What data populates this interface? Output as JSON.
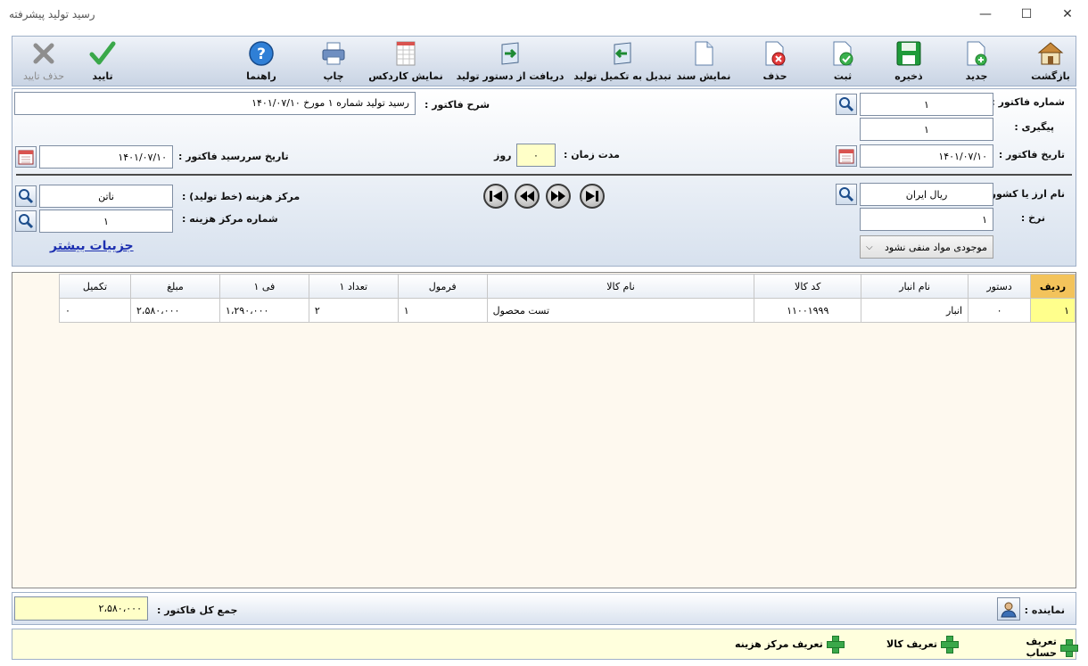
{
  "window": {
    "title": "رسید تولید  پیشرفته",
    "minimize": "—",
    "maximize": "☐",
    "close": "✕"
  },
  "toolbar": {
    "back": "بازگشت",
    "new": "جدید",
    "save": "ذخیره",
    "register": "ثبت",
    "delete": "حذف",
    "show_doc": "نمایش سند",
    "convert": "تبدیل به تکمیل تولید",
    "receive": "دریافت از دستور تولید",
    "kardex": "نمایش کاردکس",
    "print": "چاپ",
    "help": "راهنما",
    "confirm": "تایید",
    "remove_confirm": "حذف تایید"
  },
  "header": {
    "invoice_no_label": "شماره فاکتور :",
    "invoice_no": "۱",
    "followup_label": "پیگیری :",
    "followup": "۱",
    "invoice_date_label": "تاریخ فاکتور :",
    "invoice_date": "۱۴۰۱/۰۷/۱۰",
    "desc_label": "شرح فاکتور :",
    "desc": "رسید تولید شماره ۱ مورخ ۱۴۰۱/۰۷/۱۰",
    "duration_label": "مدت زمان :",
    "duration": "۰",
    "day_label": "روز",
    "due_date_label": "تاریخ سررسید فاکتور :",
    "due_date": "۱۴۰۱/۰۷/۱۰",
    "currency_label": "نام ارز یا کشور :",
    "currency": "ریال ایران",
    "rate_label": "نرخ :",
    "rate": "۱",
    "stock_option": "موجودی مواد منفی نشود",
    "cost_center_label": "مرکز هزینه (خط تولید) :",
    "cost_center": "ناتن",
    "cost_center_no_label": "شماره مرکز هزینه :",
    "cost_center_no": "۱",
    "more_details": "جزییات بیشتر"
  },
  "grid": {
    "columns": [
      "ردیف",
      "دستور",
      "نام انبار",
      "کد کالا",
      "نام کالا",
      "فرمول",
      "تعداد ۱",
      "فی ۱",
      "مبلغ",
      "تکمیل"
    ],
    "rows": [
      [
        "۱",
        "۰",
        "انبار",
        "۱۱۰۰۱۹۹۹",
        "تست محصول",
        "۱",
        "۲",
        "۱،۲۹۰،۰۰۰",
        "۲،۵۸۰،۰۰۰",
        "۰"
      ]
    ]
  },
  "footer": {
    "rep_label": "نماینده :",
    "total_label": "جمع کل فاکتور :",
    "total": "۲،۵۸۰،۰۰۰"
  },
  "bottom": {
    "define_account": "تعریف حساب",
    "define_item": "تعریف کالا",
    "define_cost_center": "تعریف مرکز هزینه"
  }
}
